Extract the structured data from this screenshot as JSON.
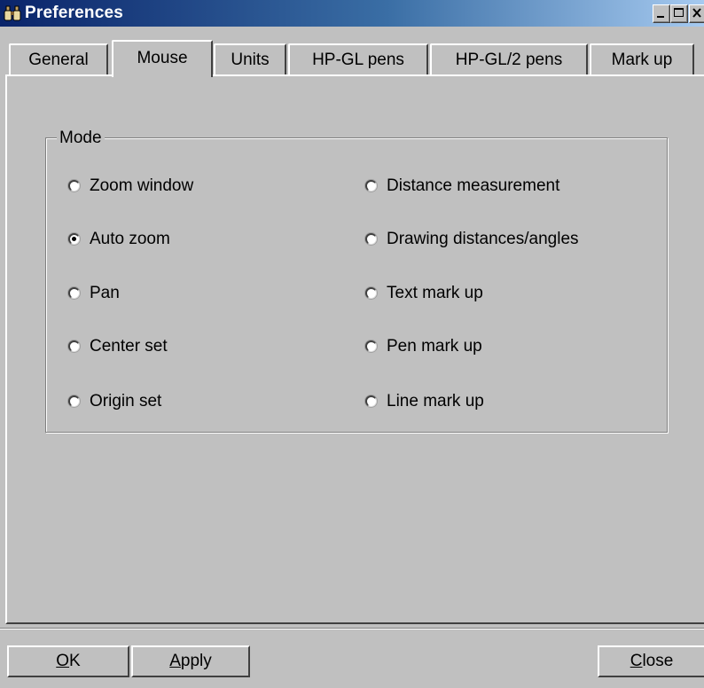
{
  "window": {
    "title": "Preferences",
    "icon": "binoculars-icon"
  },
  "title_buttons": {
    "minimize": "minimize-icon",
    "maximize": "maximize-icon",
    "close": "close-icon"
  },
  "tabs": [
    {
      "label": "General",
      "active": false
    },
    {
      "label": "Mouse",
      "active": true
    },
    {
      "label": "Units",
      "active": false
    },
    {
      "label": "HP-GL pens",
      "active": false
    },
    {
      "label": "HP-GL/2 pens",
      "active": false
    },
    {
      "label": "Mark up",
      "active": false
    }
  ],
  "mode_group": {
    "label": "Mode",
    "options_left": [
      {
        "label": "Zoom window",
        "checked": false
      },
      {
        "label": "Auto zoom",
        "checked": true
      },
      {
        "label": "Pan",
        "checked": false
      },
      {
        "label": "Center set",
        "checked": false
      },
      {
        "label": "Origin set",
        "checked": false
      }
    ],
    "options_right": [
      {
        "label": "Distance measurement",
        "checked": false
      },
      {
        "label": "Drawing distances/angles",
        "checked": false
      },
      {
        "label": "Text mark up",
        "checked": false
      },
      {
        "label": "Pen mark up",
        "checked": false
      },
      {
        "label": "Line mark up",
        "checked": false
      }
    ]
  },
  "buttons": {
    "ok": {
      "mnemonic": "O",
      "rest": "K"
    },
    "apply": {
      "mnemonic": "A",
      "rest": "pply"
    },
    "close": {
      "mnemonic": "C",
      "rest": "lose"
    }
  },
  "colors": {
    "face": "#c0c0c0",
    "titlebar_start": "#0a246a",
    "titlebar_end": "#a6caf0"
  }
}
